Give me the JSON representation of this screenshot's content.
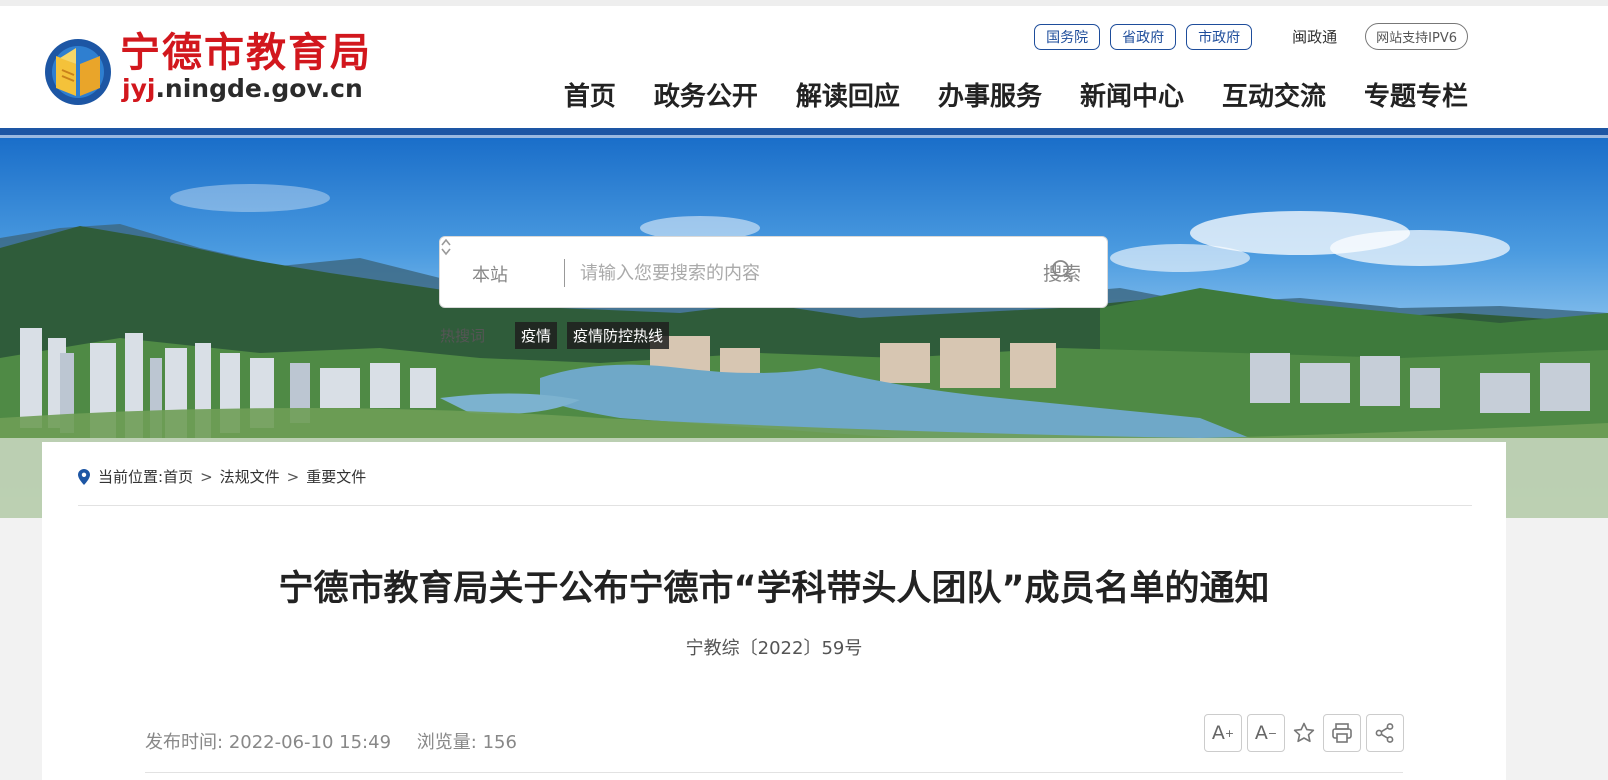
{
  "header": {
    "logo_title": "宁德市教育局",
    "logo_domain_prefix": "jyj",
    "logo_domain_rest": ".ningde.gov.cn",
    "top_links": [
      "国务院",
      "省政府",
      "市政府"
    ],
    "min_zheng_tong": "闽政通",
    "ipv6_badge": "网站支持IPV6",
    "nav": [
      "首页",
      "政务公开",
      "解读回应",
      "办事服务",
      "新闻中心",
      "互动交流",
      "专题专栏"
    ]
  },
  "search": {
    "scope": "本站",
    "placeholder": "请输入您要搜索的内容",
    "button_label": "搜索",
    "hot_label": "热搜词",
    "hot_tags": [
      "疫情",
      "疫情防控热线"
    ]
  },
  "breadcrumb": {
    "prefix": "当前位置:",
    "items": [
      "首页",
      "法规文件",
      "重要文件"
    ],
    "separator": ">"
  },
  "article": {
    "title": "宁德市教育局关于公布宁德市“学科带头人团队”成员名单的通知",
    "doc_number": "宁教综〔2022〕59号",
    "publish_label": "发布时间:",
    "publish_time": "2022-06-10 15:49",
    "views_label": "浏览量:",
    "views": "156"
  },
  "tools": {
    "font_up": "A",
    "font_up_sup": "+",
    "font_down": "A",
    "font_down_sup": "−",
    "icons": [
      "star-icon",
      "print-icon",
      "share-icon"
    ]
  },
  "colors": {
    "brand_red": "#d2171d",
    "brand_blue": "#1d56a4",
    "nav_text": "#222222"
  }
}
